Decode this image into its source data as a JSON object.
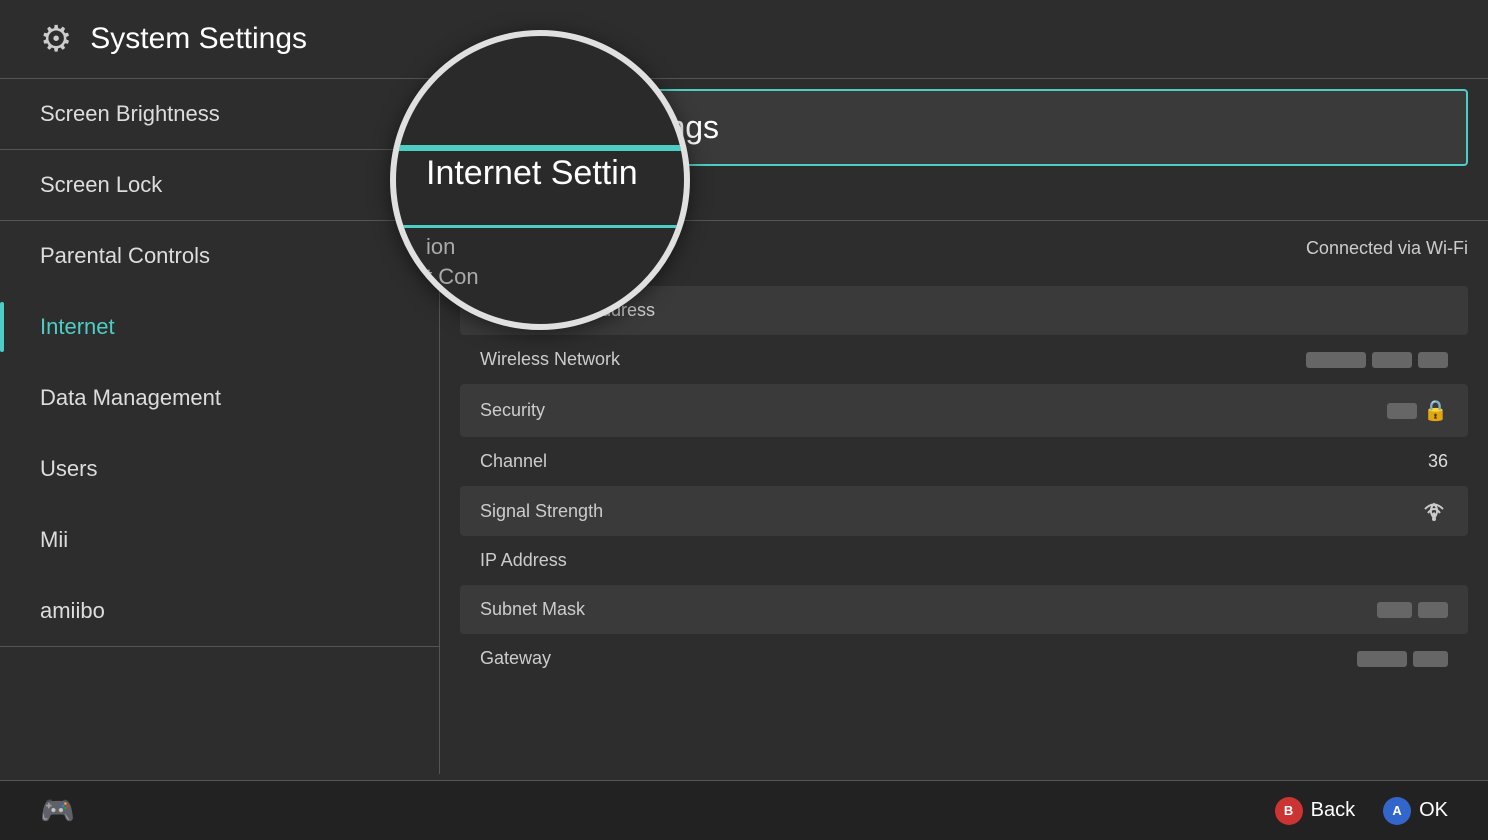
{
  "header": {
    "icon": "⚙",
    "title": "System Settings"
  },
  "sidebar": {
    "items": [
      {
        "id": "screen-brightness",
        "label": "Screen Brightness",
        "divider": true,
        "active": false
      },
      {
        "id": "screen-lock",
        "label": "Screen Lock",
        "divider": true,
        "active": false
      },
      {
        "id": "parental-controls",
        "label": "Parental Controls",
        "divider": false,
        "active": false
      },
      {
        "id": "internet",
        "label": "Internet",
        "divider": false,
        "active": true
      },
      {
        "id": "data-management",
        "label": "Data Management",
        "divider": false,
        "active": false
      },
      {
        "id": "users",
        "label": "Users",
        "divider": false,
        "active": false
      },
      {
        "id": "mii",
        "label": "Mii",
        "divider": false,
        "active": false
      },
      {
        "id": "amiibo",
        "label": "amiibo",
        "divider": true,
        "active": false
      }
    ]
  },
  "main": {
    "selected_title": "Internet Settings",
    "subtitle": "Connection",
    "subtitle_partial": "t Con___ion",
    "connection_status_label": "Connection Status",
    "connection_status_value": "Connected via Wi-Fi",
    "rows": [
      {
        "id": "mac-address",
        "label": "System MAC Address",
        "value": ""
      },
      {
        "id": "wireless-network",
        "label": "Wireless Network",
        "value": "blurred"
      },
      {
        "id": "security",
        "label": "Security",
        "value": "blurred_lock"
      },
      {
        "id": "channel",
        "label": "Channel",
        "value": "36"
      },
      {
        "id": "signal-strength",
        "label": "Signal Strength",
        "value": "wifi"
      },
      {
        "id": "ip-address",
        "label": "IP Address",
        "value": ""
      },
      {
        "id": "subnet-mask",
        "label": "Subnet Mask",
        "value": "blurred"
      },
      {
        "id": "gateway",
        "label": "Gateway",
        "value": "blurred"
      }
    ]
  },
  "magnifier": {
    "title": "Internet Settin",
    "subtitle": "ion",
    "partial": "t Con___ion"
  },
  "footer": {
    "back_label": "Back",
    "ok_label": "OK",
    "btn_b": "B",
    "btn_a": "A"
  }
}
